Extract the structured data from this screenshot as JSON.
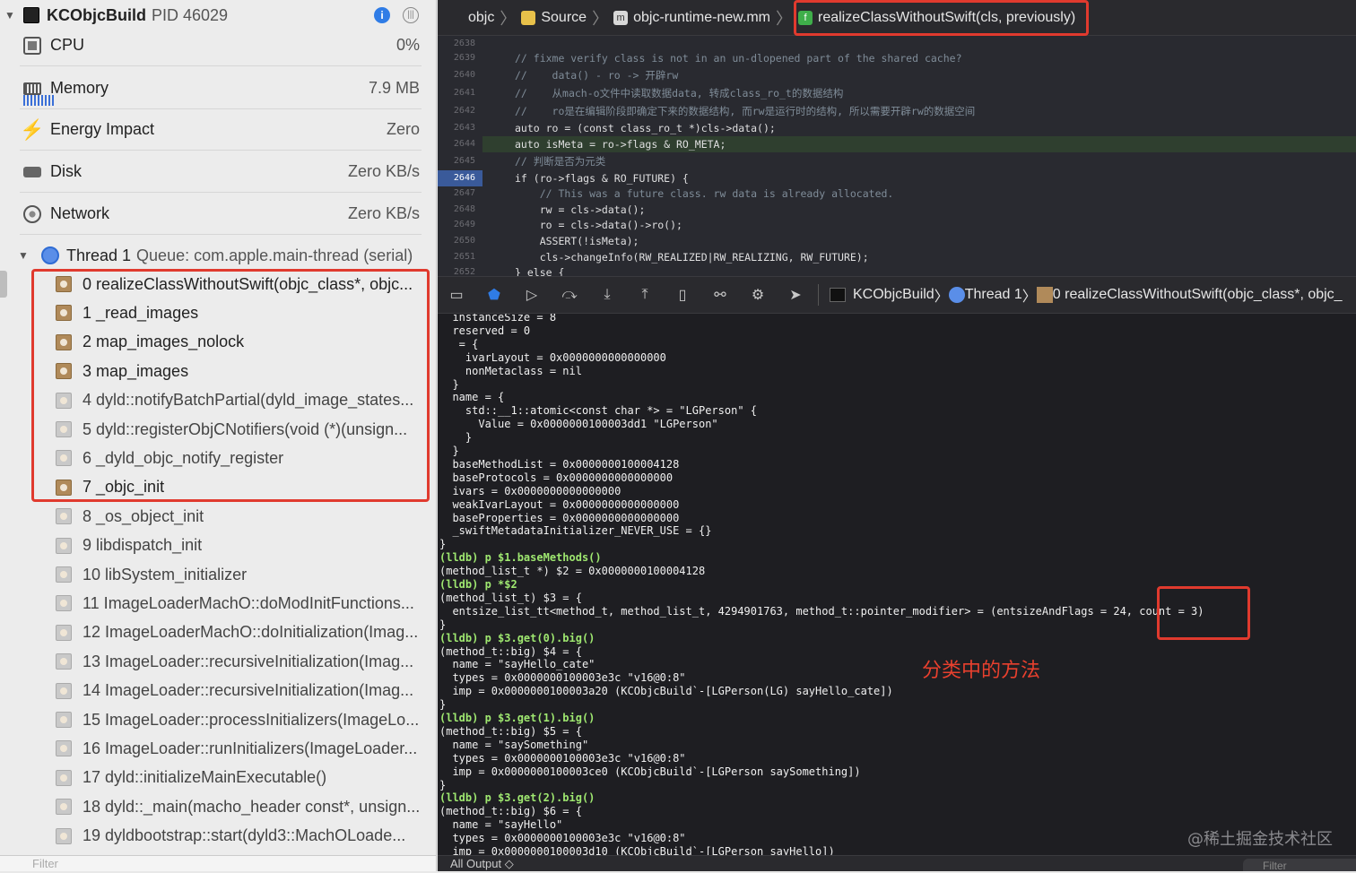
{
  "process": {
    "name": "KCObjcBuild",
    "pid": "PID 46029"
  },
  "gauges": [
    {
      "label": "CPU",
      "value": "0%"
    },
    {
      "label": "Memory",
      "value": "7.9 MB"
    },
    {
      "label": "Energy Impact",
      "value": "Zero"
    },
    {
      "label": "Disk",
      "value": "Zero KB/s"
    },
    {
      "label": "Network",
      "value": "Zero KB/s"
    }
  ],
  "thread": {
    "name": "Thread 1",
    "queue": "Queue: com.apple.main-thread (serial)"
  },
  "frames": [
    "0 realizeClassWithoutSwift(objc_class*, objc...",
    "1 _read_images",
    "2 map_images_nolock",
    "3 map_images",
    "4 dyld::notifyBatchPartial(dyld_image_states...",
    "5 dyld::registerObjCNotifiers(void (*)(unsign...",
    "6 _dyld_objc_notify_register",
    "7 _objc_init",
    "8 _os_object_init",
    "9 libdispatch_init",
    "10 libSystem_initializer",
    "11 ImageLoaderMachO::doModInitFunctions...",
    "12 ImageLoaderMachO::doInitialization(Imag...",
    "13 ImageLoader::recursiveInitialization(Imag...",
    "14 ImageLoader::recursiveInitialization(Imag...",
    "15 ImageLoader::processInitializers(ImageLo...",
    "16 ImageLoader::runInitializers(ImageLoader...",
    "17 dyld::initializeMainExecutable()",
    "18 dyld::_main(macho_header const*, unsign...",
    "19 dyldbootstrap::start(dyld3::MachOLoade..."
  ],
  "left_filter_placeholder": "Filter",
  "breadcrumb": [
    "objc",
    "Source",
    "objc-runtime-new.mm",
    "realizeClassWithoutSwift(cls, previously)"
  ],
  "editor": {
    "line_numbers": [
      "2638",
      "2639",
      "2640",
      "2641",
      "2642",
      "2643",
      "2644",
      "2645",
      "2646",
      "2647",
      "2648",
      "2649",
      "2650",
      "2651",
      "2652"
    ],
    "current_line": "2646",
    "lines": [
      "",
      "// fixme verify class is not in an un-dlopened part of the shared cache?",
      "//    data() - ro -> 开辟rw",
      "//    从mach-o文件中读取数据data, 转成class_ro_t的数据结构",
      "//    ro是在编辑阶段即确定下来的数据结构, 而rw是运行时的结构, 所以需要开辟rw的数据空间",
      "auto ro = (const class_ro_t *)cls->data();",
      "auto isMeta = ro->flags & RO_META;",
      "// 判断是否为元类",
      "if (ro->flags & RO_FUTURE) {",
      "    // This was a future class. rw data is already allocated.",
      "    rw = cls->data();",
      "    ro = cls->data()->ro();",
      "    ASSERT(!isMeta);",
      "    cls->changeInfo(RW_REALIZED|RW_REALIZING, RW_FUTURE);",
      "} else {"
    ]
  },
  "debug_bar": {
    "target": "KCObjcBuild",
    "thread": "Thread 1",
    "frame": "0 realizeClassWithoutSwift(objc_class*, objc_"
  },
  "console": [
    "  instanceSize = 8",
    "  reserved = 0",
    "   = {",
    "    ivarLayout = 0x0000000000000000",
    "    nonMetaclass = nil",
    "  }",
    "  name = {",
    "    std::__1::atomic<const char *> = \"LGPerson\" {",
    "      Value = 0x0000000100003dd1 \"LGPerson\"",
    "    }",
    "  }",
    "  baseMethodList = 0x0000000100004128",
    "  baseProtocols = 0x0000000000000000",
    "  ivars = 0x0000000000000000",
    "  weakIvarLayout = 0x0000000000000000",
    "  baseProperties = 0x0000000000000000",
    "  _swiftMetadataInitializer_NEVER_USE = {}",
    "}",
    "(lldb) p $1.baseMethods()",
    "(method_list_t *) $2 = 0x0000000100004128",
    "(lldb) p *$2",
    "(method_list_t) $3 = {",
    "  entsize_list_tt<method_t, method_list_t, 4294901763, method_t::pointer_modifier> = (entsizeAndFlags = 24, count = 3)",
    "}",
    "(lldb) p $3.get(0).big()",
    "(method_t::big) $4 = {",
    "  name = \"sayHello_cate\"",
    "  types = 0x0000000100003e3c \"v16@0:8\"",
    "  imp = 0x0000000100003a20 (KCObjcBuild`-[LGPerson(LG) sayHello_cate])",
    "}",
    "(lldb) p $3.get(1).big()",
    "(method_t::big) $5 = {",
    "  name = \"saySomething\"",
    "  types = 0x0000000100003e3c \"v16@0:8\"",
    "  imp = 0x0000000100003ce0 (KCObjcBuild`-[LGPerson saySomething])",
    "}",
    "(lldb) p $3.get(2).big()",
    "(method_t::big) $6 = {",
    "  name = \"sayHello\"",
    "  types = 0x0000000100003e3c \"v16@0:8\"",
    "  imp = 0x0000000100003d10 (KCObjcBuild`-[LGPerson sayHello])"
  ],
  "annotation": "分类中的方法",
  "watermark": "@稀土掘金技术社区",
  "output_label": "All Output ◇",
  "right_filter_placeholder": "Filter"
}
